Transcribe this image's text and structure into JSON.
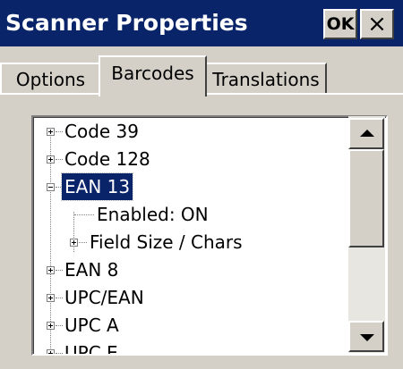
{
  "window": {
    "title": "Scanner Properties",
    "ok_label": "OK",
    "close_label": "×"
  },
  "tabs": [
    {
      "label": "Options",
      "active": false
    },
    {
      "label": "Barcodes",
      "active": true
    },
    {
      "label": "Translations",
      "active": false
    }
  ],
  "tree": {
    "items": [
      {
        "label": "Code 39",
        "expander": "plus"
      },
      {
        "label": "Code 128",
        "expander": "plus"
      },
      {
        "label": "EAN 13",
        "expander": "minus",
        "selected": true
      },
      {
        "label": "Enabled: ON"
      },
      {
        "label": "Field Size / Chars",
        "expander": "plus"
      },
      {
        "label": "EAN 8",
        "expander": "plus"
      },
      {
        "label": "UPC/EAN",
        "expander": "plus"
      },
      {
        "label": "UPC A",
        "expander": "plus"
      },
      {
        "label": "UPC E",
        "expander": "plus"
      }
    ]
  },
  "colors": {
    "titlebar": "#0a246a",
    "selection": "#0a246a",
    "face": "#d4d0c8"
  },
  "icons": {
    "close": "close-icon",
    "scroll_up": "arrow-up-icon",
    "scroll_down": "arrow-down-icon",
    "expand": "plus-box-icon",
    "collapse": "minus-box-icon"
  }
}
